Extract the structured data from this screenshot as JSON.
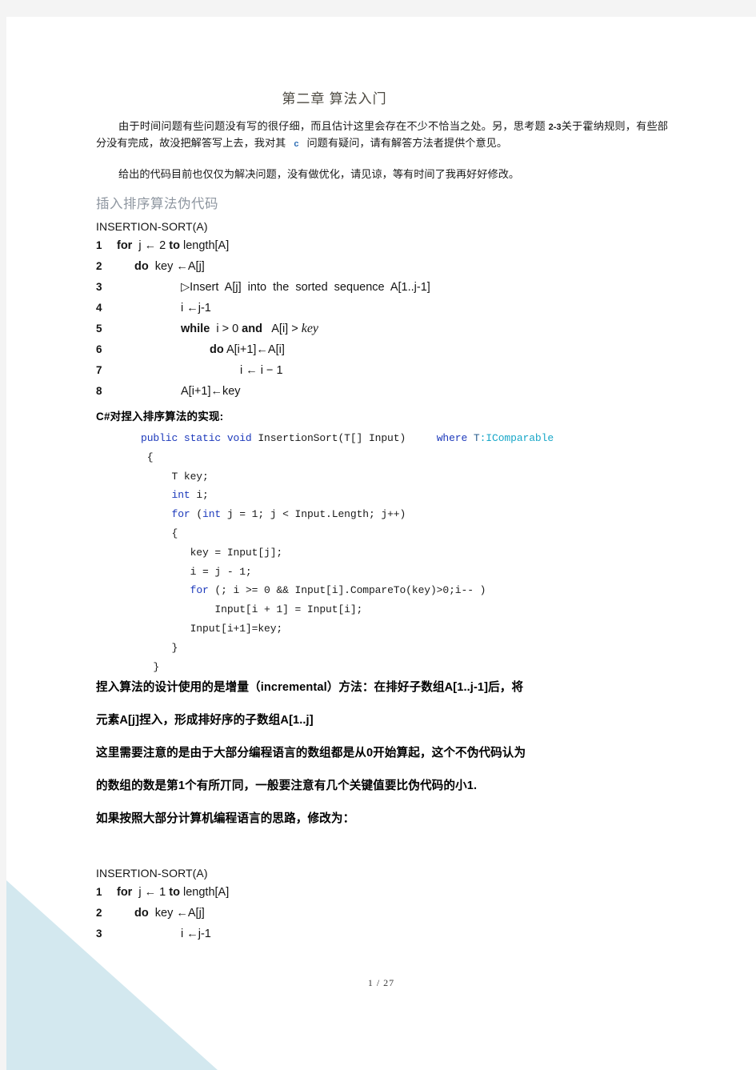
{
  "document": {
    "title": "第二章  算法入门",
    "page_background": "#ffffff",
    "canvas_background": "#f4f4f4",
    "accent_color": "#d3e8ef",
    "heading_color": "#8e96a0",
    "title_color": "#4d4a42"
  },
  "intro": {
    "paragraph_1_part_1": "由于时间问题有些问题没有写的很仔细，而且估计这里会存在不少不恰当之处。另，思考题 ",
    "paragraph_1_ref": "2-3",
    "paragraph_1_part_2": "关于霍纳规则，有些部分没有完成，故没把解答写上去，我对其",
    "paragraph_1_marker": "c",
    "paragraph_1_part_3": "问题有疑问，请有解答方法者提供个意见。",
    "paragraph_2": "给出的代码目前也仅仅为解决问题，没有做优化，请见谅，等有时间了我再好好修改。"
  },
  "section_heading": "插入排序算法伪代码",
  "pseudocode_1": {
    "header": "INSERTION-SORT(A)",
    "lines": [
      {
        "num": "1",
        "indent": 0,
        "text": "for  j ← 2 to length[A]"
      },
      {
        "num": "2",
        "indent": 22,
        "text": "do  key ←A[j]"
      },
      {
        "num": "3",
        "indent": 80,
        "text": "▷Insert  A[j]  into  the  sorted  sequence  A[1..j-1]"
      },
      {
        "num": "4",
        "indent": 80,
        "text": "i ←j-1"
      },
      {
        "num": "5",
        "indent": 80,
        "text": "while  i > 0 and   A[i] > key"
      },
      {
        "num": "6",
        "indent": 116,
        "text": "do A[i+1]←A[i]"
      },
      {
        "num": "7",
        "indent": 154,
        "text": "i ← i − 1"
      },
      {
        "num": "8",
        "indent": 80,
        "text": "A[i+1]←key"
      }
    ]
  },
  "implementation_label": "C#对捏入排序算法的实现:",
  "csharp_code": [
    {
      "segments": [
        {
          "text": "public static void ",
          "style": "kw"
        },
        {
          "text": "InsertionSort(T[] Input)",
          "style": "plain"
        },
        {
          "text": "     ",
          "style": "plain"
        },
        {
          "text": "where ",
          "style": "kw"
        },
        {
          "text": "T",
          "style": "type"
        },
        {
          "text": ":IComparable",
          "style": "iface"
        }
      ]
    },
    {
      "segments": [
        {
          "text": " {",
          "style": "plain"
        }
      ]
    },
    {
      "segments": [
        {
          "text": "     T key;",
          "style": "plain"
        }
      ]
    },
    {
      "segments": [
        {
          "text": "     ",
          "style": "plain"
        },
        {
          "text": "int",
          "style": "kw"
        },
        {
          "text": " i;",
          "style": "plain"
        }
      ]
    },
    {
      "segments": [
        {
          "text": "     ",
          "style": "plain"
        },
        {
          "text": "for",
          "style": "kw"
        },
        {
          "text": " (",
          "style": "plain"
        },
        {
          "text": "int",
          "style": "kw"
        },
        {
          "text": " j = 1; j < Input.Length; j++)",
          "style": "plain"
        }
      ]
    },
    {
      "segments": [
        {
          "text": "     {",
          "style": "plain"
        }
      ]
    },
    {
      "segments": [
        {
          "text": "        key = Input[j];",
          "style": "plain"
        }
      ]
    },
    {
      "segments": [
        {
          "text": "        i = j - 1;",
          "style": "plain"
        }
      ]
    },
    {
      "segments": [
        {
          "text": "        ",
          "style": "plain"
        },
        {
          "text": "for",
          "style": "kw"
        },
        {
          "text": " (; i >= 0 && Input[i].CompareTo(key)>0;i-- )",
          "style": "plain"
        }
      ]
    },
    {
      "segments": [
        {
          "text": "            Input[i + 1] = Input[i];",
          "style": "plain"
        }
      ]
    },
    {
      "segments": [
        {
          "text": "        Input[i+1]=key;",
          "style": "plain"
        }
      ]
    },
    {
      "segments": [
        {
          "text": "     }",
          "style": "plain"
        }
      ]
    },
    {
      "segments": [
        {
          "text": "  }",
          "style": "plain"
        }
      ]
    }
  ],
  "commentary": {
    "bold_1_line_1": "捏入算法的设计使用的是增量（incremental）方法：在排好子数组A[1..j-1]后，将",
    "bold_1_line_2": "元素A[j]捏入，形成排好序的子数组A[1..j]",
    "bold_2_line_1": "这里需要注意的是由于大部分编程语言的数组都是从0开始算起，这个不伪代码认为",
    "bold_2_line_2": "的数组的数是第1个有所丌同，一般要注意有几个关键值要比伪代码的小1.",
    "bold_3": "如果按照大部分计算机编程语言的思路，修改为："
  },
  "pseudocode_2": {
    "header": "INSERTION-SORT(A)",
    "lines": [
      {
        "num": "1",
        "indent": 0,
        "text": "for  j ← 1 to length[A]"
      },
      {
        "num": "2",
        "indent": 22,
        "text": "do  key ←A[j]"
      },
      {
        "num": "3",
        "indent": 80,
        "text": "i ←j-1"
      }
    ]
  },
  "footer": {
    "page_indicator": "1 / 27"
  }
}
